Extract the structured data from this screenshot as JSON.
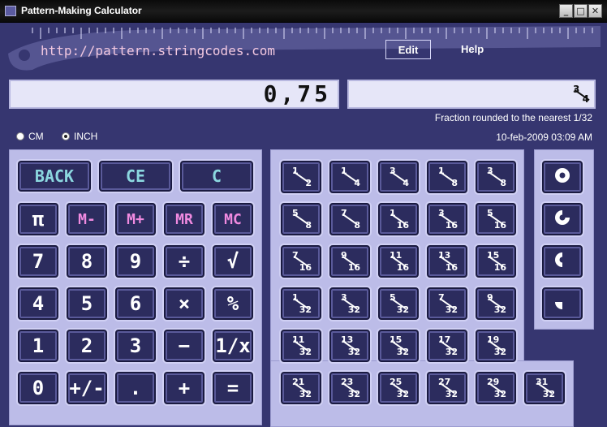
{
  "window": {
    "title": "Pattern-Making Calculator"
  },
  "header": {
    "url": "http://pattern.stringcodes.com",
    "edit_label": "Edit",
    "help_label": "Help"
  },
  "display": {
    "value": "0,75",
    "fraction": {
      "num": "3",
      "den": "4"
    },
    "note": "Fraction rounded to the nearest 1/32",
    "date": "10-feb-2009 03:09 AM"
  },
  "units": {
    "cm": "CM",
    "inch": "INCH",
    "selected": "inch"
  },
  "keys": {
    "row0": [
      "BACK",
      "CE",
      "C"
    ],
    "mem": [
      "π",
      "M-",
      "M+",
      "MR",
      "MC"
    ],
    "row1": [
      "7",
      "8",
      "9",
      "÷",
      "√"
    ],
    "row2": [
      "4",
      "5",
      "6",
      "×",
      "%"
    ],
    "row3": [
      "1",
      "2",
      "3",
      "−",
      "1/x"
    ],
    "row4": [
      "0",
      "+/-",
      ".",
      "+",
      "="
    ]
  },
  "fractions": [
    [
      "1",
      "2"
    ],
    [
      "1",
      "4"
    ],
    [
      "3",
      "4"
    ],
    [
      "1",
      "8"
    ],
    [
      "3",
      "8"
    ],
    [
      "5",
      "8"
    ],
    [
      "7",
      "8"
    ],
    [
      "1",
      "16"
    ],
    [
      "3",
      "16"
    ],
    [
      "5",
      "16"
    ],
    [
      "7",
      "16"
    ],
    [
      "9",
      "16"
    ],
    [
      "11",
      "16"
    ],
    [
      "13",
      "16"
    ],
    [
      "15",
      "16"
    ],
    [
      "1",
      "32"
    ],
    [
      "3",
      "32"
    ],
    [
      "5",
      "32"
    ],
    [
      "7",
      "32"
    ],
    [
      "9",
      "32"
    ],
    [
      "11",
      "32"
    ],
    [
      "13",
      "32"
    ],
    [
      "15",
      "32"
    ],
    [
      "17",
      "32"
    ],
    [
      "19",
      "32"
    ],
    [
      "21",
      "32"
    ],
    [
      "23",
      "32"
    ],
    [
      "25",
      "32"
    ],
    [
      "27",
      "32"
    ],
    [
      "29",
      "32"
    ],
    [
      "31",
      "32"
    ]
  ],
  "shape_keys": [
    "full-circle-icon",
    "three-quarter-circle-icon",
    "half-circle-icon",
    "quarter-circle-icon"
  ]
}
